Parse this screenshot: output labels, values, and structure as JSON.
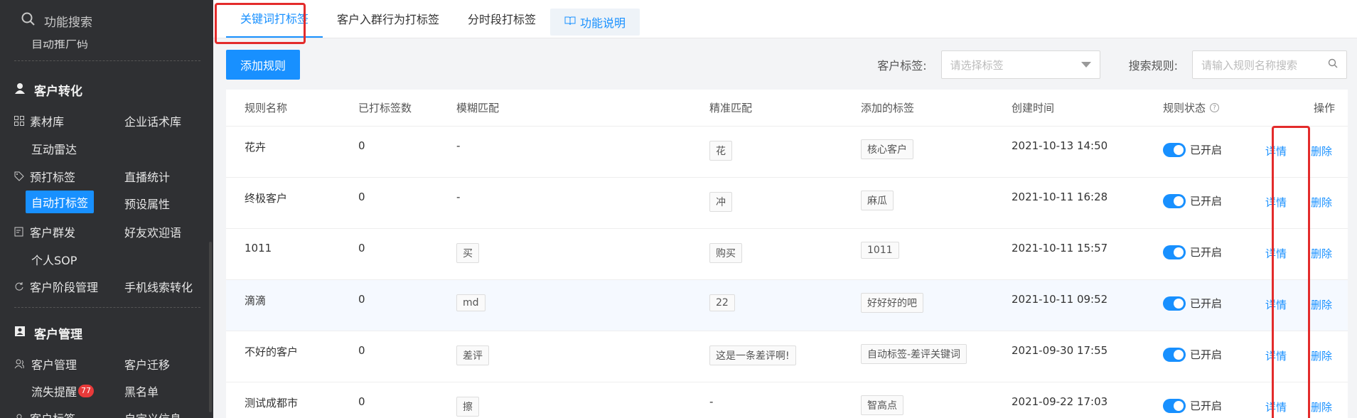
{
  "sidebar": {
    "search_placeholder": "功能搜索",
    "partial_item": "自动推广码",
    "section_conversion": "客户转化",
    "items_conversion": [
      "素材库",
      "企业话术库",
      "互动雷达",
      "预打标签",
      "直播统计",
      "自动打标签",
      "预设属性",
      "客户群发",
      "好友欢迎语",
      "个人SOP",
      "客户阶段管理",
      "手机线索转化"
    ],
    "section_customer": "客户管理",
    "items_customer": [
      "客户管理",
      "客户迁移",
      "流失提醒",
      "黑名单",
      "客户标签",
      "自定义信息"
    ],
    "badge_count": "77"
  },
  "tabs": {
    "t1": "关键词打标签",
    "t2": "客户入群行为打标签",
    "t3": "分时段打标签",
    "help": "功能说明"
  },
  "toolbar": {
    "add_button": "添加规则",
    "tag_label": "客户标签:",
    "tag_placeholder": "请选择标签",
    "search_label": "搜索规则:",
    "search_placeholder": "请输入规则名称搜索"
  },
  "table": {
    "headers": [
      "规则名称",
      "已打标签数",
      "模糊匹配",
      "精准匹配",
      "添加的标签",
      "创建时间",
      "规则状态",
      "操作"
    ],
    "rows": [
      {
        "name": "花卉",
        "count": "0",
        "fuzzy": "-",
        "exact": "花",
        "tag": "核心客户",
        "time": "2021-10-13 14:50",
        "status": "已开启"
      },
      {
        "name": "终极客户",
        "count": "0",
        "fuzzy": "-",
        "exact": "冲",
        "tag": "麻瓜",
        "time": "2021-10-11 16:28",
        "status": "已开启"
      },
      {
        "name": "1011",
        "count": "0",
        "fuzzy": "买",
        "exact": "购买",
        "tag": "1011",
        "time": "2021-10-11 15:57",
        "status": "已开启"
      },
      {
        "name": "滴滴",
        "count": "0",
        "fuzzy": "md",
        "exact": "22",
        "tag": "好好好的吧",
        "time": "2021-10-11 09:52",
        "status": "已开启"
      },
      {
        "name": "不好的客户",
        "count": "0",
        "fuzzy": "差评",
        "exact": "这是一条差评啊!",
        "tag": "自动标签-差评关键词",
        "time": "2021-09-30 17:55",
        "status": "已开启"
      },
      {
        "name": "测试成都市",
        "count": "0",
        "fuzzy": "擦",
        "exact": "-",
        "tag": "智高点",
        "time": "2021-09-22 17:03",
        "status": "已开启"
      }
    ],
    "detail_label": "详情",
    "delete_label": "删除"
  }
}
